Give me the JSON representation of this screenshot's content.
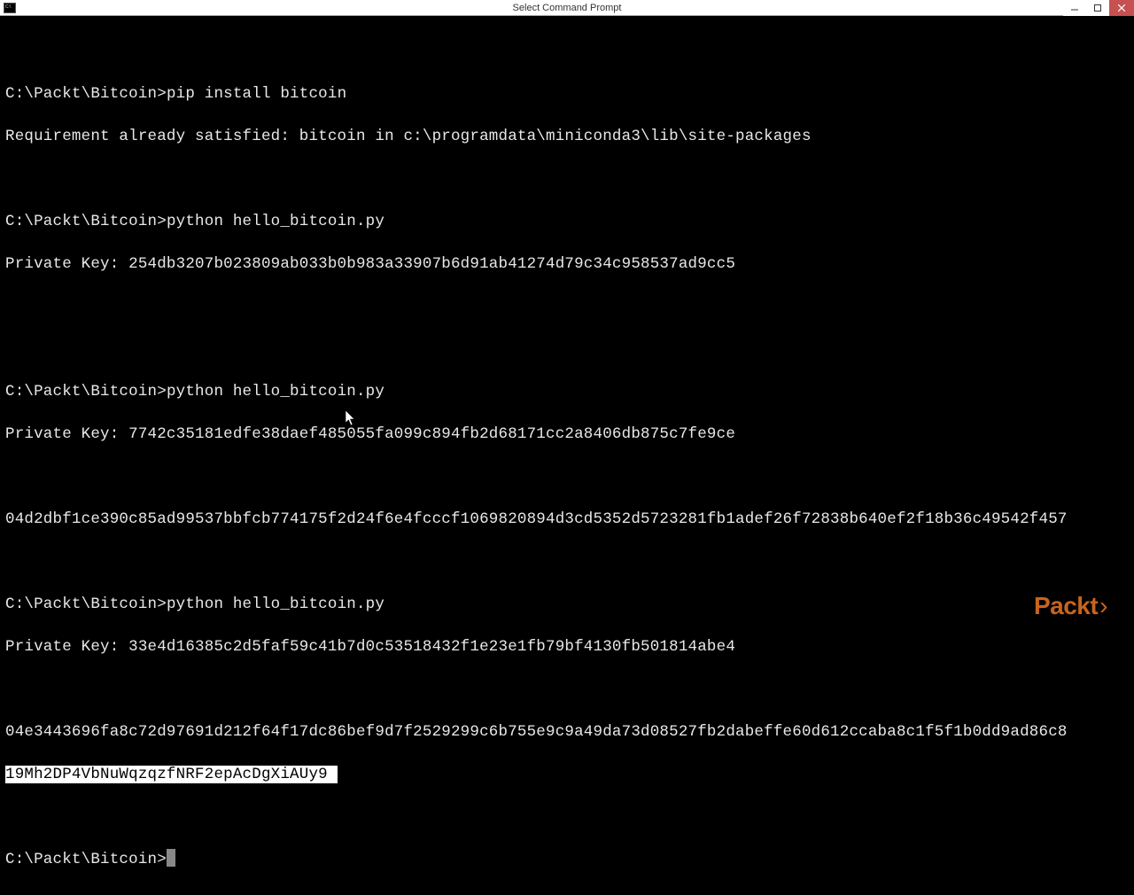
{
  "window": {
    "title": "Select Command Prompt",
    "icon_name": "cmd-icon"
  },
  "prompt": "C:\\Packt\\Bitcoin>",
  "lines": {
    "l1_cmd": "pip install bitcoin",
    "l2": "Requirement already satisfied: bitcoin in c:\\programdata\\miniconda3\\lib\\site-packages",
    "l3_cmd": "python hello_bitcoin.py",
    "l4": "Private Key: 254db3207b023809ab033b0b983a33907b6d91ab41274d79c34c958537ad9cc5",
    "l5_cmd": "python hello_bitcoin.py",
    "l6": "Private Key: 7742c35181edfe38daef485055fa099c894fb2d68171cc2a8406db875c7fe9ce",
    "l7": "04d2dbf1ce390c85ad99537bbfcb774175f2d24f6e4fcccf1069820894d3cd5352d5723281fb1adef26f72838b640ef2f18b36c49542f457",
    "l8_cmd": "python hello_bitcoin.py",
    "l9": "Private Key: 33e4d16385c2d5faf59c41b7d0c53518432f1e23e1fb79bf4130fb501814abe4",
    "l10": "04e3443696fa8c72d97691d212f64f17dc86bef9d7f2529299c6b755e9c9a49da73d08527fb2dabeffe60d612ccaba8c1f5f1b0dd9ad86c8",
    "l11_selected": "19Mh2DP4VbNuWqzqzfNRF2epAcDgXiAUy9 "
  },
  "watermark": {
    "brand": "Packt",
    "chevron": "›"
  }
}
